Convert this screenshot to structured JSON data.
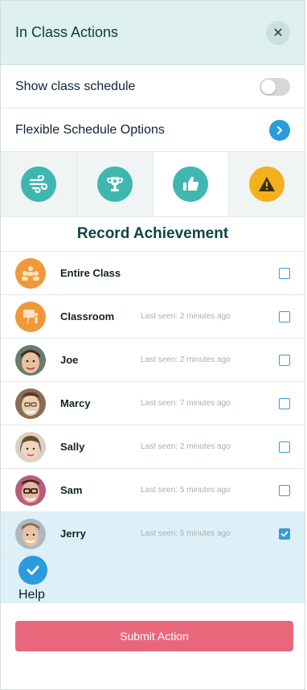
{
  "header": {
    "title": "In Class Actions",
    "close_icon": "close-icon"
  },
  "settings": {
    "show_schedule_label": "Show class schedule",
    "show_schedule_on": false,
    "flexible_label": "Flexible Schedule Options"
  },
  "tabs": [
    {
      "icon": "wind-icon",
      "color": "#3fb7b0",
      "active": false
    },
    {
      "icon": "trophy-icon",
      "color": "#3fb7b0",
      "active": false
    },
    {
      "icon": "thumbs-up-icon",
      "color": "#3fb7b0",
      "active": true
    },
    {
      "icon": "warning-icon",
      "color": "#f2b01e",
      "active": false
    }
  ],
  "section_title": "Record Achievement",
  "students": [
    {
      "name": "Entire Class",
      "seen": "",
      "checked": false
    },
    {
      "name": "Classroom",
      "seen": "Last seen: 2 minutes ago",
      "checked": false
    },
    {
      "name": "Joe",
      "seen": "Last seen: 2 minutes ago",
      "checked": false
    },
    {
      "name": "Marcy",
      "seen": "Last seen: 7 minutes ago",
      "checked": false
    },
    {
      "name": "Sally",
      "seen": "Last seen: 2 minutes ago",
      "checked": false
    },
    {
      "name": "Sam",
      "seen": "Last seen: 5 minutes ago",
      "checked": false
    },
    {
      "name": "Jerry",
      "seen": "Last seen: 5 minutes ago",
      "checked": true
    }
  ],
  "help": {
    "label": "Help"
  },
  "submit": {
    "label": "Submit Action"
  },
  "colors": {
    "accent": "#3fb7b0",
    "submit": "#e9677b",
    "checkbox": "#3a9ad6",
    "selected_row": "#def0f7"
  }
}
